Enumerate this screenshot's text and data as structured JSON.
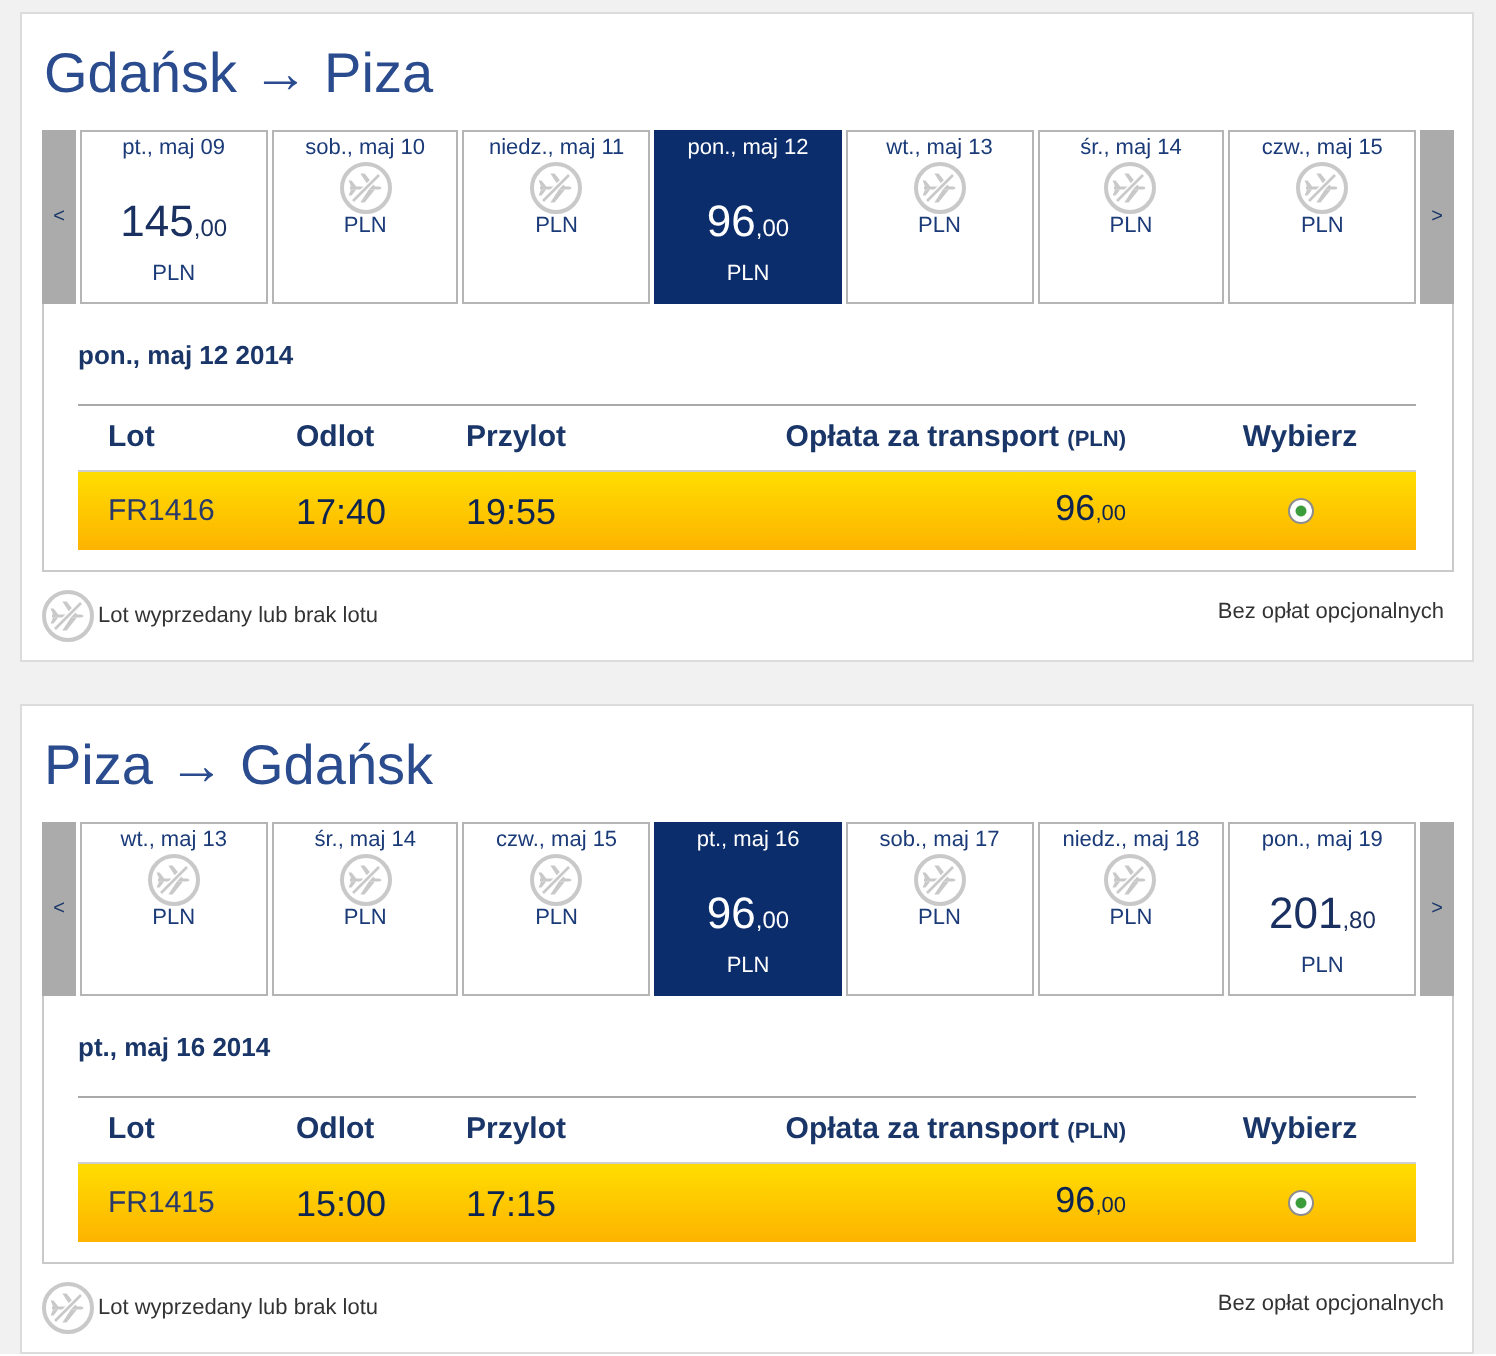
{
  "journeys": [
    {
      "title": "Gdańsk → Piza",
      "date_strip": {
        "previous": "<",
        "next": ">",
        "days": [
          {
            "kind": "price",
            "date": "pt., maj 09",
            "price": "145",
            "decimals": ",00",
            "currency": "PLN",
            "selected": false
          },
          {
            "kind": "no_flight",
            "date": "sob., maj 10",
            "currency": "PLN",
            "selected": false
          },
          {
            "kind": "no_flight",
            "date": "niedz., maj 11",
            "currency": "PLN",
            "selected": false
          },
          {
            "kind": "price",
            "date": "pon., maj 12",
            "price": "96",
            "decimals": ",00",
            "currency": "PLN",
            "selected": true
          },
          {
            "kind": "no_flight",
            "date": "wt., maj 13",
            "currency": "PLN",
            "selected": false
          },
          {
            "kind": "no_flight",
            "date": "śr., maj 14",
            "currency": "PLN",
            "selected": false
          },
          {
            "kind": "no_flight",
            "date": "czw., maj 15",
            "currency": "PLN",
            "selected": false
          }
        ]
      },
      "selected_date": "pon., maj 12 2014",
      "table": {
        "columns": [
          {
            "label": "Lot"
          },
          {
            "label": "Odlot"
          },
          {
            "label": "Przylot"
          },
          {
            "label": "Opłata za transport",
            "unit": "(PLN)"
          },
          {
            "label": "Wybierz"
          }
        ],
        "rows": [
          {
            "flight": "FR1416",
            "departure": "17:40",
            "arrival": "19:55",
            "fare": "96",
            "fare_decimals": ",00",
            "selected": true
          }
        ]
      },
      "legend": "Lot wyprzedany lub brak lotu",
      "note": "Bez opłat opcjonalnych"
    },
    {
      "title": "Piza → Gdańsk",
      "date_strip": {
        "previous": "<",
        "next": ">",
        "days": [
          {
            "kind": "no_flight",
            "date": "wt., maj 13",
            "currency": "PLN",
            "selected": false
          },
          {
            "kind": "no_flight",
            "date": "śr., maj 14",
            "currency": "PLN",
            "selected": false
          },
          {
            "kind": "no_flight",
            "date": "czw., maj 15",
            "currency": "PLN",
            "selected": false
          },
          {
            "kind": "price",
            "date": "pt., maj 16",
            "price": "96",
            "decimals": ",00",
            "currency": "PLN",
            "selected": true
          },
          {
            "kind": "no_flight",
            "date": "sob., maj 17",
            "currency": "PLN",
            "selected": false
          },
          {
            "kind": "no_flight",
            "date": "niedz., maj 18",
            "currency": "PLN",
            "selected": false
          },
          {
            "kind": "price",
            "date": "pon., maj 19",
            "price": "201",
            "decimals": ",80",
            "currency": "PLN",
            "selected": false
          }
        ]
      },
      "selected_date": "pt., maj 16 2014",
      "table": {
        "columns": [
          {
            "label": "Lot"
          },
          {
            "label": "Odlot"
          },
          {
            "label": "Przylot"
          },
          {
            "label": "Opłata za transport",
            "unit": "(PLN)"
          },
          {
            "label": "Wybierz"
          }
        ],
        "rows": [
          {
            "flight": "FR1415",
            "departure": "15:00",
            "arrival": "17:15",
            "fare": "96",
            "fare_decimals": ",00",
            "selected": true
          }
        ]
      },
      "legend": "Lot wyprzedany lub brak lotu",
      "note": "Bez opłat opcjonalnych"
    }
  ]
}
